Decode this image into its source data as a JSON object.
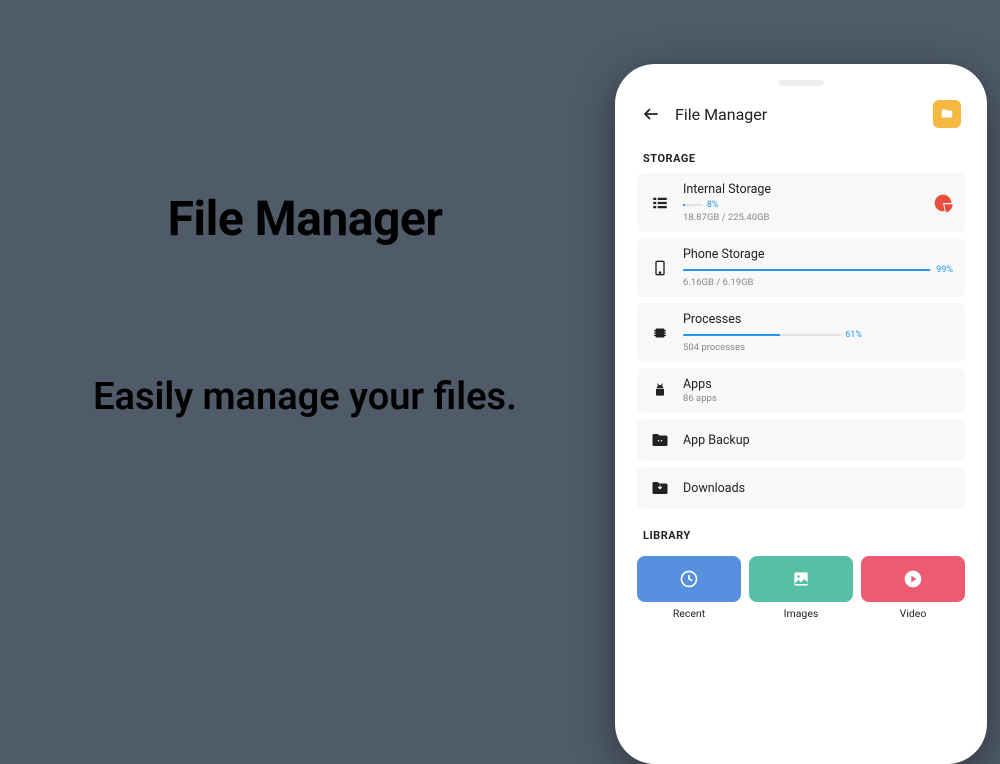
{
  "promo": {
    "title": "File Manager",
    "subtitle": "Easily manage your files."
  },
  "header": {
    "title": "File Manager"
  },
  "sections": {
    "storage_label": "STORAGE",
    "library_label": "LIBRARY"
  },
  "storage": {
    "internal": {
      "title": "Internal Storage",
      "pct_label": "8%",
      "pct": 8,
      "sub": "18.87GB / 225.40GB"
    },
    "phone": {
      "title": "Phone Storage",
      "pct_label": "99%",
      "pct": 99,
      "sub": "6.16GB / 6.19GB"
    },
    "processes": {
      "title": "Processes",
      "pct_label": "61%",
      "pct": 61,
      "sub": "504 processes"
    },
    "apps": {
      "title": "Apps",
      "sub": "86 apps"
    },
    "backup": {
      "title": "App Backup"
    },
    "downloads": {
      "title": "Downloads"
    }
  },
  "library": {
    "recent": "Recent",
    "images": "Images",
    "video": "Video"
  },
  "colors": {
    "accent_yellow": "#F5B942",
    "progress_blue": "#2196F3",
    "pie_red": "#E94E3C",
    "tile_blue": "#5690DF",
    "tile_teal": "#58BFA7",
    "tile_pink": "#ED5B73"
  }
}
